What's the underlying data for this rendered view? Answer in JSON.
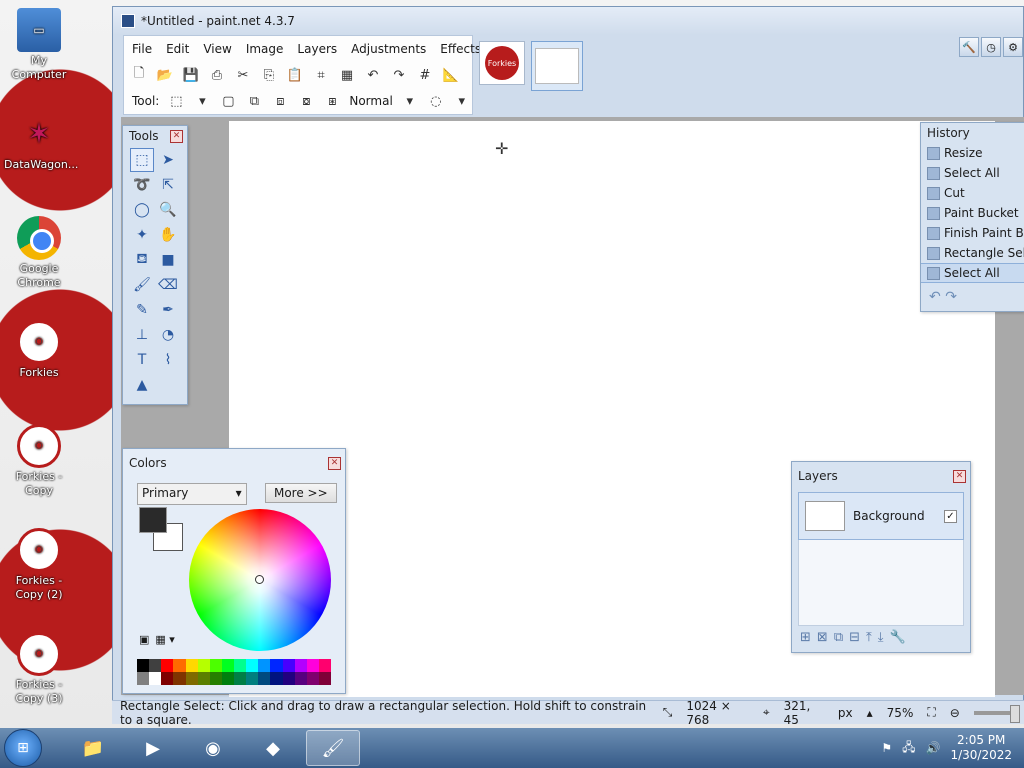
{
  "desktop": {
    "icons": [
      {
        "label": "My Computer",
        "icon": "computer-icon"
      },
      {
        "label": "DataWagon...",
        "icon": "datawagon-icon"
      },
      {
        "label": "Google Chrome",
        "icon": "chrome-icon"
      },
      {
        "label": "Forkies",
        "icon": "forkies-icon"
      },
      {
        "label": "Forkies - Copy",
        "icon": "forkies-icon"
      },
      {
        "label": "Forkies - Copy (2)",
        "icon": "forkies-icon"
      },
      {
        "label": "Forkies - Copy (3)",
        "icon": "forkies-icon"
      }
    ]
  },
  "window": {
    "title": "*Untitled - paint.net 4.3.7"
  },
  "menu": [
    "File",
    "Edit",
    "View",
    "Image",
    "Layers",
    "Adjustments",
    "Effects"
  ],
  "toolbar": {
    "tool_label": "Tool:",
    "blend_mode": "Normal"
  },
  "thumbnails": {
    "forkies_logo_text": "Forkies"
  },
  "tools_panel": {
    "title": "Tools"
  },
  "history_panel": {
    "title": "History",
    "items": [
      "Resize",
      "Select All",
      "Cut",
      "Paint Bucket",
      "Finish Paint Bu",
      "Rectangle Sele",
      "Select All"
    ],
    "active_index": 6
  },
  "colors_panel": {
    "title": "Colors",
    "mode": "Primary",
    "more_label": "More >>",
    "palette": [
      "#000000",
      "#404040",
      "#ff0000",
      "#ff6a00",
      "#ffd800",
      "#b6ff00",
      "#4cff00",
      "#00ff21",
      "#00ff90",
      "#00ffff",
      "#0094ff",
      "#0026ff",
      "#4800ff",
      "#b200ff",
      "#ff00dc",
      "#ff006e",
      "#808080",
      "#ffffff",
      "#7f0000",
      "#7f3300",
      "#7f6a00",
      "#5b7f00",
      "#267f00",
      "#007f0e",
      "#007f46",
      "#007f7f",
      "#004a7f",
      "#00137f",
      "#21007f",
      "#57007f",
      "#7f006e",
      "#7f0037"
    ]
  },
  "layers_panel": {
    "title": "Layers",
    "layers": [
      {
        "name": "Background",
        "visible": true
      }
    ]
  },
  "statusbar": {
    "hint": "Rectangle Select: Click and drag to draw a rectangular selection. Hold shift to constrain to a square.",
    "image_size": "1024 × 768",
    "cursor_pos": "321, 45",
    "unit": "px",
    "zoom": "75%"
  },
  "taskbar": {
    "time": "2:05 PM",
    "date": "1/30/2022"
  }
}
